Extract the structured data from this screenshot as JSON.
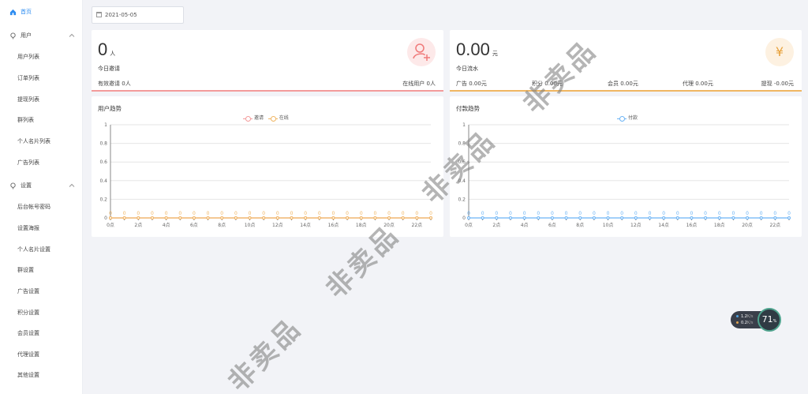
{
  "sidebar": {
    "home": "首页",
    "group_user": "用户",
    "user_items": [
      "用户列表",
      "订单列表",
      "提现列表",
      "群列表",
      "个人名片列表",
      "广告列表"
    ],
    "group_settings": "设置",
    "settings_items": [
      "后台帐号密码",
      "设置海报",
      "个人名片设置",
      "群设置",
      "广告设置",
      "积分设置",
      "会员设置",
      "代理设置",
      "其他设置"
    ]
  },
  "date_picker": {
    "value": "2021-05-05"
  },
  "user_card": {
    "count": "0",
    "unit": "人",
    "label": "今日邀请",
    "valid_label": "有效邀请",
    "valid_value": "0人",
    "online_label": "在线用户",
    "online_value": "0人",
    "accent": "#f39b9b"
  },
  "money_card": {
    "amount": "0.00",
    "unit": "元",
    "label": "今日流水",
    "currency_symbol": "¥",
    "accent": "#f0b663",
    "items": [
      {
        "label": "广告",
        "value": "0.00元"
      },
      {
        "label": "积分",
        "value": "0.00元"
      },
      {
        "label": "会员",
        "value": "0.00元"
      },
      {
        "label": "代理",
        "value": "0.00元"
      },
      {
        "label": "提现",
        "value": "-0.00元"
      }
    ]
  },
  "chart_data": [
    {
      "type": "line",
      "title": "用户趋势",
      "x": [
        "0点",
        "1点",
        "2点",
        "3点",
        "4点",
        "5点",
        "6点",
        "7点",
        "8点",
        "9点",
        "10点",
        "11点",
        "12点",
        "13点",
        "14点",
        "15点",
        "16点",
        "17点",
        "18点",
        "19点",
        "20点",
        "21点",
        "22点",
        "23点"
      ],
      "x_tick_labels": [
        "0点",
        "2点",
        "4点",
        "6点",
        "8点",
        "10点",
        "12点",
        "14点",
        "16点",
        "18点",
        "20点",
        "22点"
      ],
      "ylim": [
        0,
        1
      ],
      "y_ticks": [
        "0",
        "0.2",
        "0.4",
        "0.6",
        "0.8",
        "1"
      ],
      "series": [
        {
          "name": "邀请",
          "color": "#f39b9b",
          "values": [
            0,
            0,
            0,
            0,
            0,
            0,
            0,
            0,
            0,
            0,
            0,
            0,
            0,
            0,
            0,
            0,
            0,
            0,
            0,
            0,
            0,
            0,
            0,
            0
          ]
        },
        {
          "name": "在线",
          "color": "#f0b663",
          "values": [
            0,
            0,
            0,
            0,
            0,
            0,
            0,
            0,
            0,
            0,
            0,
            0,
            0,
            0,
            0,
            0,
            0,
            0,
            0,
            0,
            0,
            0,
            0,
            0
          ]
        }
      ],
      "point_label": "0",
      "legend_position": "top-center",
      "grid": true
    },
    {
      "type": "line",
      "title": "付款趋势",
      "x": [
        "0点",
        "1点",
        "2点",
        "3点",
        "4点",
        "5点",
        "6点",
        "7点",
        "8点",
        "9点",
        "10点",
        "11点",
        "12点",
        "13点",
        "14点",
        "15点",
        "16点",
        "17点",
        "18点",
        "19点",
        "20点",
        "21点",
        "22点",
        "23点"
      ],
      "x_tick_labels": [
        "0点",
        "2点",
        "4点",
        "6点",
        "8点",
        "10点",
        "12点",
        "14点",
        "16点",
        "18点",
        "20点",
        "22点"
      ],
      "ylim": [
        0,
        1
      ],
      "y_ticks": [
        "0",
        "0.2",
        "0.4",
        "0.6",
        "0.8",
        "1"
      ],
      "series": [
        {
          "name": "付款",
          "color": "#6cb4f5",
          "values": [
            0,
            0,
            0,
            0,
            0,
            0,
            0,
            0,
            0,
            0,
            0,
            0,
            0,
            0,
            0,
            0,
            0,
            0,
            0,
            0,
            0,
            0,
            0,
            0
          ]
        }
      ],
      "point_label": "0",
      "legend_position": "top-center",
      "grid": true
    }
  ],
  "monitor": {
    "up": "1.2",
    "up_unit": "K/s",
    "down": "0.2",
    "down_unit": "K/s",
    "percent": "71",
    "percent_unit": "%"
  },
  "watermark": "非卖品"
}
